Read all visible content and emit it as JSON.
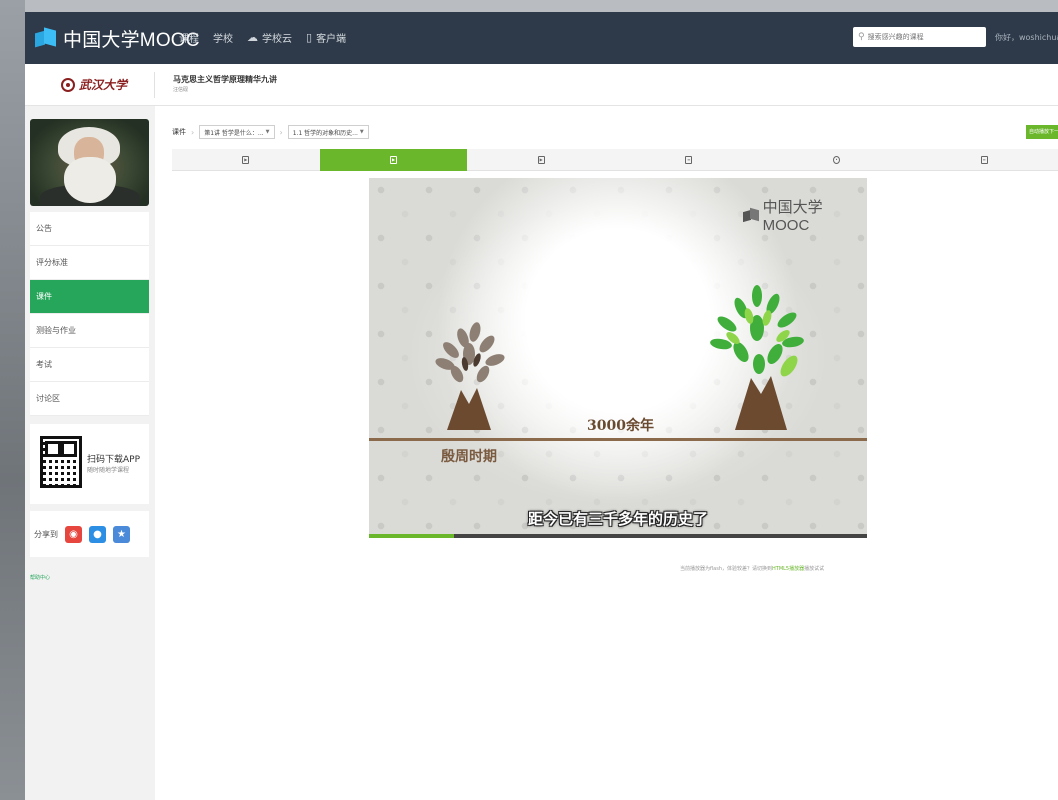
{
  "topnav": {
    "logo_text": "中国大学MOOC",
    "items": [
      {
        "label": "课程",
        "icon": ""
      },
      {
        "label": "学校",
        "icon": ""
      },
      {
        "label": "学校云",
        "icon": "cloud-icon"
      },
      {
        "label": "客户端",
        "icon": "phone-icon"
      }
    ],
    "search_placeholder": "搜索感兴趣的课程",
    "greeting": "你好，woshichua..."
  },
  "course": {
    "school_name": "武汉大学",
    "title": "马克思主义哲学原理精华九讲",
    "subtitle": "汪信砚"
  },
  "sidebar": {
    "menu": [
      {
        "label": "公告",
        "active": false
      },
      {
        "label": "评分标准",
        "active": false
      },
      {
        "label": "课件",
        "active": true
      },
      {
        "label": "测验与作业",
        "active": false
      },
      {
        "label": "考试",
        "active": false
      },
      {
        "label": "讨论区",
        "active": false
      }
    ],
    "app_title": "扫码下载APP",
    "app_sub": "随时随地学课程",
    "share_label": "分享到",
    "help_link": "帮助中心"
  },
  "main": {
    "breadcrumb_root": "课件",
    "chapter_select": "第1讲 哲学是什么：...",
    "lesson_select": "1.1 哲学的对象和历史...",
    "auto_button": "自动播放下一个",
    "tabs": [
      {
        "icon": "video-icon",
        "active": false
      },
      {
        "icon": "video-icon",
        "active": true
      },
      {
        "icon": "video-icon",
        "active": false
      },
      {
        "icon": "document-icon",
        "active": false
      },
      {
        "icon": "discussion-icon",
        "active": false
      },
      {
        "icon": "quiz-icon",
        "active": false
      }
    ]
  },
  "video": {
    "logo_text": "中国大学MOOC",
    "era_left": "殷周时期",
    "era_mid": "3000余年",
    "subtitle": "距今已有三千多年的历史了",
    "progress": 0.17
  },
  "notice": {
    "text": "当前播放器为flash，体验较差？请切换到",
    "link": "HTML5播放器",
    "tail": "播放试试"
  },
  "colors": {
    "nav_bg": "#2e3a49",
    "accent_green": "#26a65b",
    "tab_green": "#6ab72c"
  }
}
